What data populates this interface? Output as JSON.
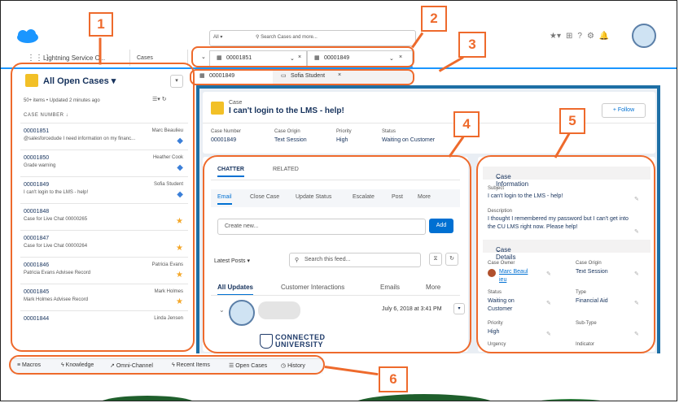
{
  "global_search": {
    "scope": "All",
    "placeholder": "Search Cases and more..."
  },
  "nav": {
    "app_name": "Lightning Service C...",
    "nav_tab": "Cases"
  },
  "workspace_tabs": [
    {
      "label": "00001851",
      "close": "×"
    },
    {
      "label": "00001849",
      "close": "×"
    }
  ],
  "subtabs": [
    {
      "label": "00001849"
    },
    {
      "label": "Sofia Student",
      "close": "×"
    }
  ],
  "list": {
    "title": "All Open Cases",
    "meta": "50+ items • Updated 2 minutes ago",
    "column": "CASE NUMBER",
    "rows": [
      {
        "number": "00001851",
        "subject": "@salesforcedude I need information on my financ...",
        "owner": "Marc Beaulieu",
        "mark": "diamond"
      },
      {
        "number": "00001850",
        "subject": "Grade warning",
        "owner": "Heather Cook",
        "mark": "diamond"
      },
      {
        "number": "00001849",
        "subject": "I can't login to the LMS - help!",
        "owner": "Sofia Student",
        "mark": "diamond"
      },
      {
        "number": "00001848",
        "subject": "Case for Live Chat 00000265",
        "owner": "",
        "mark": "star"
      },
      {
        "number": "00001847",
        "subject": "Case for Live Chat 00000264",
        "owner": "",
        "mark": "star"
      },
      {
        "number": "00001846",
        "subject": "Patricia Evans Advisee Record",
        "owner": "Patricia Evans",
        "mark": "star"
      },
      {
        "number": "00001845",
        "subject": "Mark Holmes Advisee Record",
        "owner": "Mark Holmes",
        "mark": "star"
      },
      {
        "number": "00001844",
        "subject": "",
        "owner": "Linda Jensen",
        "mark": ""
      }
    ]
  },
  "case": {
    "label": "Case",
    "title": "I can't login to the LMS - help!",
    "follow": "+ Follow",
    "fields": [
      {
        "label": "Case Number",
        "value": "00001849"
      },
      {
        "label": "Case Origin",
        "value": "Text Session"
      },
      {
        "label": "Priority",
        "value": "High"
      },
      {
        "label": "Status",
        "value": "Waiting on Customer"
      }
    ]
  },
  "chatter": {
    "tabs": [
      "CHATTER",
      "RELATED"
    ],
    "publisher_tabs": [
      "Email",
      "Close Case",
      "Update Status",
      "Escalate",
      "Post",
      "More"
    ],
    "composer_placeholder": "Create new...",
    "add": "Add",
    "sort": "Latest Posts",
    "search_placeholder": "Search this feed...",
    "feed_tabs": [
      "All Updates",
      "Customer Interactions",
      "Emails",
      "More"
    ],
    "post_date": "July 6, 2018 at 3:41 PM",
    "logo_text": "CONNECTED UNIVERSITY"
  },
  "details": {
    "section1": "Case Information",
    "subject_label": "Subject",
    "subject": "I can't login to the LMS - help!",
    "description_label": "Description",
    "description": "I thought I remembered my password but I can't get into the CU LMS right now. Please help!",
    "section2": "Case Details",
    "owner_label": "Case Owner",
    "owner": "Marc Beaul ieu",
    "origin_label": "Case Origin",
    "origin": "Text Session",
    "status_label": "Status",
    "status": "Waiting on Customer",
    "type_label": "Type",
    "type": "Financial Aid",
    "priority_label": "Priority",
    "priority": "High",
    "subtype_label": "Sub-Type",
    "urgency_label": "Urgency",
    "indicator_label": "Indicator"
  },
  "utility_bar": [
    "Macros",
    "Knowledge",
    "Omni-Channel",
    "Recent Items",
    "Open Cases",
    "History"
  ],
  "callouts": [
    "1",
    "2",
    "3",
    "4",
    "5",
    "6"
  ],
  "colors": {
    "accent": "#ee6a2c",
    "brand": "#1b96ff",
    "primary_button": "#0070d2",
    "case_icon": "#f2c027"
  }
}
